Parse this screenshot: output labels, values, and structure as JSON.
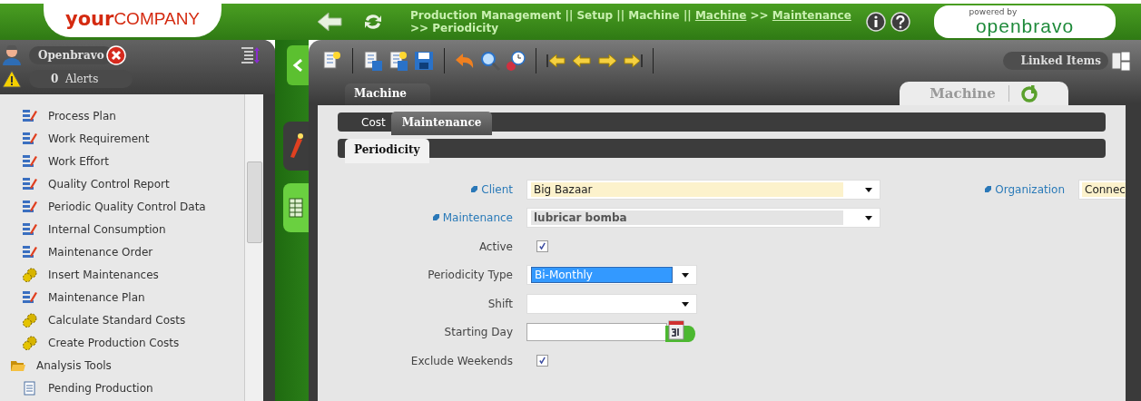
{
  "header": {
    "logo": {
      "bold": "your",
      "plain": "COMPANY"
    },
    "breadcrumb": [
      {
        "text": "Production Management || Setup || Machine ||",
        "link": false
      },
      {
        "text": "Machine",
        "link": true
      },
      {
        "text": ">>",
        "link": false
      },
      {
        "text": "Maintenance",
        "link": true
      },
      {
        "text": ">> Periodicity",
        "link": false
      }
    ],
    "powered": {
      "caption": "powered by",
      "name": "openbravo"
    }
  },
  "sidebar": {
    "user": "Openbravo",
    "alerts": {
      "count": "0",
      "label": "Alerts"
    },
    "menu": [
      {
        "label": "Process Plan",
        "kind": "window"
      },
      {
        "label": "Work Requirement",
        "kind": "window"
      },
      {
        "label": "Work Effort",
        "kind": "window"
      },
      {
        "label": "Quality Control Report",
        "kind": "window"
      },
      {
        "label": "Periodic Quality Control Data",
        "kind": "window"
      },
      {
        "label": "Internal Consumption",
        "kind": "window"
      },
      {
        "label": "Maintenance Order",
        "kind": "window"
      },
      {
        "label": "Insert Maintenances",
        "kind": "process"
      },
      {
        "label": "Maintenance Plan",
        "kind": "window"
      },
      {
        "label": "Calculate Standard Costs",
        "kind": "process"
      },
      {
        "label": "Create Production Costs",
        "kind": "process"
      },
      {
        "label": "Analysis Tools",
        "kind": "folder",
        "expanded": true,
        "children": [
          {
            "label": "Pending Production",
            "kind": "report"
          }
        ]
      }
    ]
  },
  "toolbar": {
    "linked_items": "Linked Items"
  },
  "tabs": {
    "level1": [
      {
        "label": "Machine",
        "selected": true
      }
    ],
    "right_tab": "Machine",
    "level2": [
      {
        "label": "Cost",
        "selected": false
      },
      {
        "label": "Maintenance",
        "selected": true
      }
    ],
    "level3": [
      {
        "label": "Periodicity",
        "selected": true
      }
    ]
  },
  "form": {
    "fields": [
      {
        "label": "Client",
        "link": true,
        "kind": "select",
        "value": "Big Bazaar",
        "required": true,
        "readonly": false
      },
      {
        "label": "Maintenance",
        "link": true,
        "kind": "select",
        "value": "lubricar bomba",
        "required": false,
        "readonly": true
      },
      {
        "label": "Active",
        "link": false,
        "kind": "checkbox",
        "checked": true
      },
      {
        "label": "Periodicity Type",
        "link": false,
        "kind": "select",
        "value": "Bi-Monthly",
        "highlighted": true,
        "required": false,
        "readonly": false
      },
      {
        "label": "Shift",
        "link": false,
        "kind": "select",
        "required": false,
        "readonly": false
      },
      {
        "label": "Starting Day",
        "link": false,
        "kind": "date"
      },
      {
        "label": "Exclude Weekends",
        "link": false,
        "kind": "checkbox",
        "checked": true
      }
    ],
    "side_field": {
      "label": "Organization",
      "link": true,
      "value": "Connec",
      "required": true
    }
  }
}
